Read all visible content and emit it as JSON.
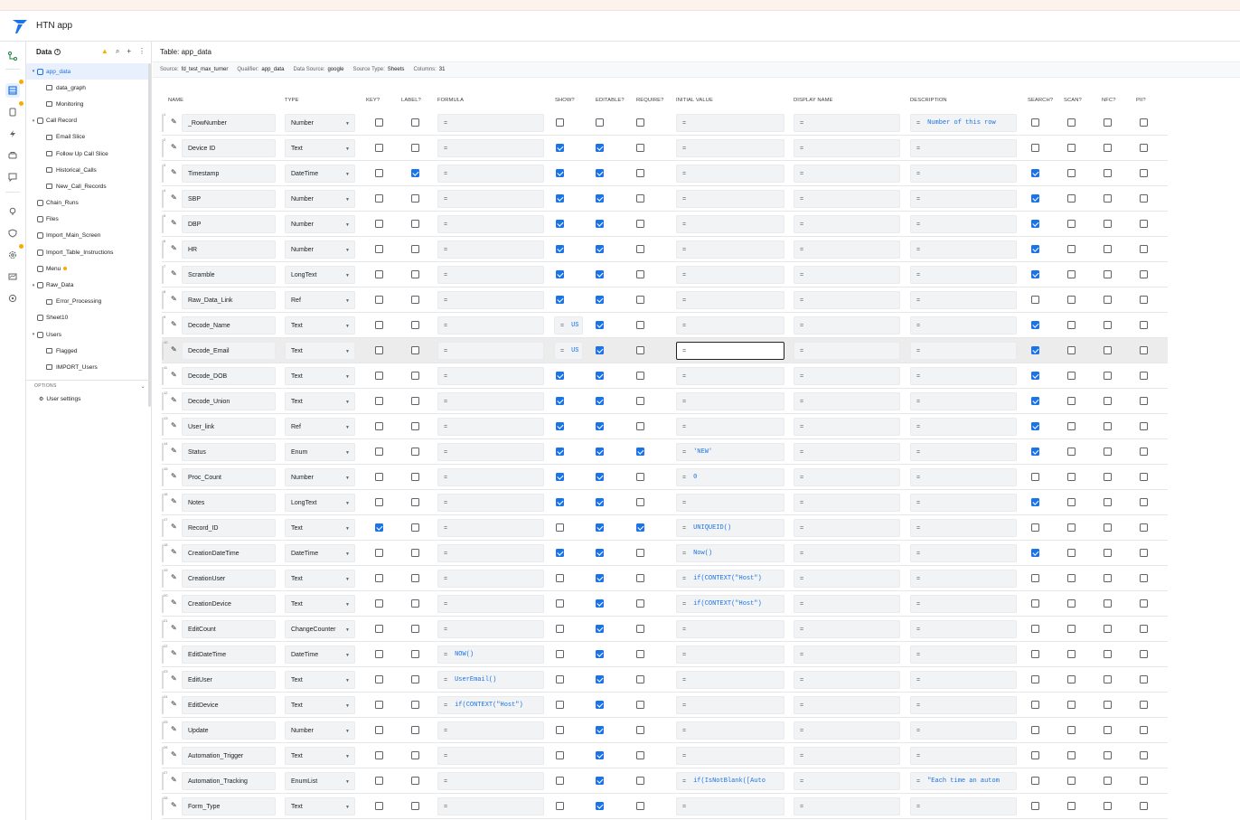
{
  "app": {
    "title": "HTN app"
  },
  "sidebar": {
    "title": "Data",
    "items": [
      {
        "label": "app_data",
        "kind": "table",
        "expanded": true,
        "selected": true
      },
      {
        "label": "data_graph",
        "kind": "slice"
      },
      {
        "label": "Monitoring",
        "kind": "slice"
      },
      {
        "label": "Call Record",
        "kind": "table",
        "expanded": true
      },
      {
        "label": "Email Slice",
        "kind": "slice"
      },
      {
        "label": "Follow Up Call Slice",
        "kind": "slice"
      },
      {
        "label": "Historical_Calls",
        "kind": "slice"
      },
      {
        "label": "New_Call_Records",
        "kind": "slice"
      },
      {
        "label": "Chain_Runs",
        "kind": "table"
      },
      {
        "label": "Files",
        "kind": "table"
      },
      {
        "label": "Import_Main_Screen",
        "kind": "table"
      },
      {
        "label": "Import_Table_Instructions",
        "kind": "table"
      },
      {
        "label": "Menu",
        "kind": "table",
        "dot": true
      },
      {
        "label": "Raw_Data",
        "kind": "table",
        "expanded": true
      },
      {
        "label": "Error_Processing",
        "kind": "slice"
      },
      {
        "label": "Sheet10",
        "kind": "table"
      },
      {
        "label": "Users",
        "kind": "table",
        "expanded": true
      },
      {
        "label": "Flagged",
        "kind": "slice"
      },
      {
        "label": "IMPORT_Users",
        "kind": "slice"
      }
    ],
    "options_label": "OPTIONS",
    "user_settings_label": "User settings"
  },
  "table": {
    "title": "Table: app_data",
    "source_label": "Source:",
    "source": "fd_test_max_turner",
    "qualifier_label": "Qualifier:",
    "qualifier": "app_data",
    "datasource_label": "Data Source:",
    "datasource": "google",
    "sourcetype_label": "Source Type:",
    "sourcetype": "Sheets",
    "columns_label": "Columns:",
    "columns": "31"
  },
  "headers": [
    "NAME",
    "TYPE",
    "KEY?",
    "LABEL?",
    "FORMULA",
    "SHOW?",
    "EDITABLE?",
    "REQUIRE?",
    "INITIAL VALUE",
    "DISPLAY NAME",
    "DESCRIPTION",
    "SEARCH?",
    "SCAN?",
    "NFC?",
    "PII?"
  ],
  "rows": [
    {
      "n": "1",
      "name": "_RowNumber",
      "type": "Number",
      "key": false,
      "label": false,
      "formula": "",
      "show": false,
      "showf": "",
      "edit": false,
      "req": false,
      "init": "",
      "disp": "",
      "desc": "Number of this row",
      "search": false
    },
    {
      "n": "2",
      "name": "Device ID",
      "type": "Text",
      "key": false,
      "label": false,
      "formula": "",
      "show": true,
      "showf": "",
      "edit": true,
      "req": false,
      "init": "",
      "disp": "",
      "desc": "",
      "search": false
    },
    {
      "n": "3",
      "name": "Timestamp",
      "type": "DateTime",
      "key": false,
      "label": true,
      "formula": "",
      "show": true,
      "showf": "",
      "edit": true,
      "req": false,
      "init": "",
      "disp": "",
      "desc": "",
      "search": true
    },
    {
      "n": "4",
      "name": "SBP",
      "type": "Number",
      "key": false,
      "label": false,
      "formula": "",
      "show": true,
      "showf": "",
      "edit": true,
      "req": false,
      "init": "",
      "disp": "",
      "desc": "",
      "search": true
    },
    {
      "n": "5",
      "name": "DBP",
      "type": "Number",
      "key": false,
      "label": false,
      "formula": "",
      "show": true,
      "showf": "",
      "edit": true,
      "req": false,
      "init": "",
      "disp": "",
      "desc": "",
      "search": true
    },
    {
      "n": "6",
      "name": "HR",
      "type": "Number",
      "key": false,
      "label": false,
      "formula": "",
      "show": true,
      "showf": "",
      "edit": true,
      "req": false,
      "init": "",
      "disp": "",
      "desc": "",
      "search": true
    },
    {
      "n": "7",
      "name": "Scramble",
      "type": "LongText",
      "key": false,
      "label": false,
      "formula": "",
      "show": true,
      "showf": "",
      "edit": true,
      "req": false,
      "init": "",
      "disp": "",
      "desc": "",
      "search": true
    },
    {
      "n": "8",
      "name": "Raw_Data_Link",
      "type": "Ref",
      "key": false,
      "label": false,
      "formula": "",
      "show": true,
      "showf": "",
      "edit": true,
      "req": false,
      "init": "",
      "disp": "",
      "desc": "",
      "search": false
    },
    {
      "n": "9",
      "name": "Decode_Name",
      "type": "Text",
      "key": false,
      "label": false,
      "formula": "",
      "show": false,
      "showf": "US",
      "edit": true,
      "req": false,
      "init": "",
      "disp": "",
      "desc": "",
      "search": true
    },
    {
      "n": "10",
      "name": "Decode_Email",
      "type": "Text",
      "key": false,
      "label": false,
      "formula": "",
      "show": false,
      "showf": "US",
      "edit": true,
      "req": false,
      "init": "",
      "disp": "",
      "desc": "",
      "search": true,
      "hl": true,
      "focus": true
    },
    {
      "n": "11",
      "name": "Decode_DOB",
      "type": "Text",
      "key": false,
      "label": false,
      "formula": "",
      "show": true,
      "showf": "",
      "edit": true,
      "req": false,
      "init": "",
      "disp": "",
      "desc": "",
      "search": true
    },
    {
      "n": "12",
      "name": "Decode_Union",
      "type": "Text",
      "key": false,
      "label": false,
      "formula": "",
      "show": true,
      "showf": "",
      "edit": true,
      "req": false,
      "init": "",
      "disp": "",
      "desc": "",
      "search": true
    },
    {
      "n": "13",
      "name": "User_link",
      "type": "Ref",
      "key": false,
      "label": false,
      "formula": "",
      "show": true,
      "showf": "",
      "edit": true,
      "req": false,
      "init": "",
      "disp": "",
      "desc": "",
      "search": true
    },
    {
      "n": "14",
      "name": "Status",
      "type": "Enum",
      "key": false,
      "label": false,
      "formula": "",
      "show": true,
      "showf": "",
      "edit": true,
      "req": true,
      "init": "'NEW'",
      "disp": "",
      "desc": "",
      "search": true
    },
    {
      "n": "15",
      "name": "Proc_Count",
      "type": "Number",
      "key": false,
      "label": false,
      "formula": "",
      "show": true,
      "showf": "",
      "edit": true,
      "req": false,
      "init": "0",
      "disp": "",
      "desc": "",
      "search": false
    },
    {
      "n": "16",
      "name": "Notes",
      "type": "LongText",
      "key": false,
      "label": false,
      "formula": "",
      "show": true,
      "showf": "",
      "edit": true,
      "req": false,
      "init": "",
      "disp": "",
      "desc": "",
      "search": true
    },
    {
      "n": "17",
      "name": "Record_ID",
      "type": "Text",
      "key": true,
      "label": false,
      "formula": "",
      "show": false,
      "showf": "",
      "edit": true,
      "req": true,
      "init": "UNIQUEID()",
      "disp": "",
      "desc": "",
      "search": false
    },
    {
      "n": "18",
      "name": "CreationDateTime",
      "type": "DateTime",
      "key": false,
      "label": false,
      "formula": "",
      "show": true,
      "showf": "",
      "edit": true,
      "req": false,
      "init": "Now()",
      "disp": "",
      "desc": "",
      "search": true
    },
    {
      "n": "19",
      "name": "CreationUser",
      "type": "Text",
      "key": false,
      "label": false,
      "formula": "",
      "show": false,
      "showf": "",
      "edit": true,
      "req": false,
      "init": "if(CONTEXT(\"Host\")",
      "disp": "",
      "desc": "",
      "search": false
    },
    {
      "n": "20",
      "name": "CreationDevice",
      "type": "Text",
      "key": false,
      "label": false,
      "formula": "",
      "show": false,
      "showf": "",
      "edit": true,
      "req": false,
      "init": "if(CONTEXT(\"Host\")",
      "disp": "",
      "desc": "",
      "search": false
    },
    {
      "n": "21",
      "name": "EditCount",
      "type": "ChangeCounter",
      "key": false,
      "label": false,
      "formula": "",
      "show": false,
      "showf": "",
      "edit": true,
      "req": false,
      "init": "",
      "disp": "",
      "desc": "",
      "search": false
    },
    {
      "n": "22",
      "name": "EditDateTime",
      "type": "DateTime",
      "key": false,
      "label": false,
      "formula": "NOW()",
      "show": false,
      "showf": "",
      "edit": true,
      "req": false,
      "init": "",
      "disp": "",
      "desc": "",
      "search": false
    },
    {
      "n": "23",
      "name": "EditUser",
      "type": "Text",
      "key": false,
      "label": false,
      "formula": "UserEmail()",
      "show": false,
      "showf": "",
      "edit": true,
      "req": false,
      "init": "",
      "disp": "",
      "desc": "",
      "search": false
    },
    {
      "n": "24",
      "name": "EditDevice",
      "type": "Text",
      "key": false,
      "label": false,
      "formula": "if(CONTEXT(\"Host\")",
      "show": false,
      "showf": "",
      "edit": true,
      "req": false,
      "init": "",
      "disp": "",
      "desc": "",
      "search": false
    },
    {
      "n": "25",
      "name": "Update",
      "type": "Number",
      "key": false,
      "label": false,
      "formula": "",
      "show": false,
      "showf": "",
      "edit": true,
      "req": false,
      "init": "",
      "disp": "",
      "desc": "",
      "search": false
    },
    {
      "n": "26",
      "name": "Automation_Trigger",
      "type": "Text",
      "key": false,
      "label": false,
      "formula": "",
      "show": false,
      "showf": "",
      "edit": true,
      "req": false,
      "init": "",
      "disp": "",
      "desc": "",
      "search": false
    },
    {
      "n": "27",
      "name": "Automation_Tracking",
      "type": "EnumList",
      "key": false,
      "label": false,
      "formula": "",
      "show": false,
      "showf": "",
      "edit": true,
      "req": false,
      "init": "if(IsNotBlank([Auto",
      "disp": "",
      "desc": "\"Each time an autom",
      "search": false
    },
    {
      "n": "28",
      "name": "Form_Type",
      "type": "Text",
      "key": false,
      "label": false,
      "formula": "",
      "show": false,
      "showf": "",
      "edit": true,
      "req": false,
      "init": "",
      "disp": "",
      "desc": "",
      "search": false
    }
  ],
  "eq_symbol": "="
}
